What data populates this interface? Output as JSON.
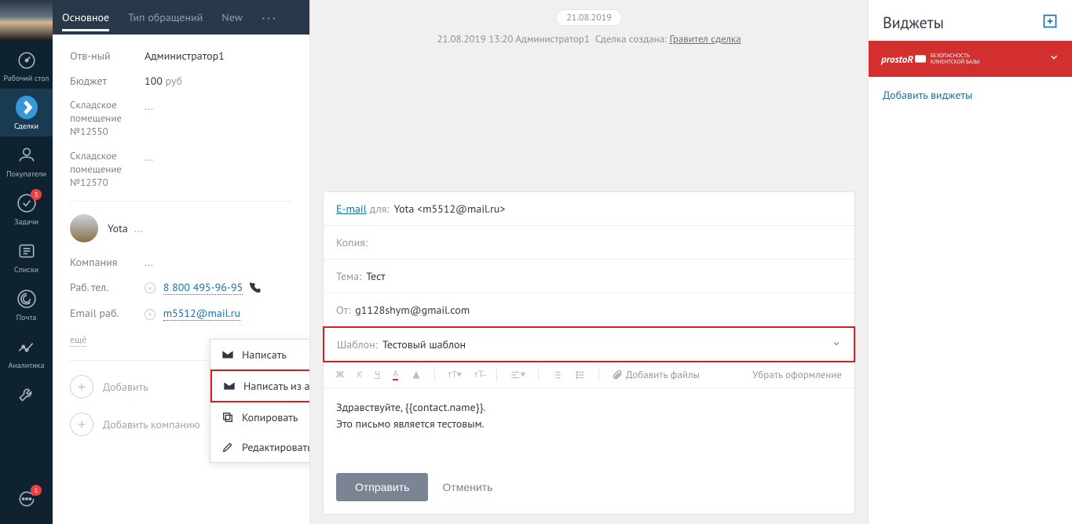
{
  "sidebar": {
    "items": [
      {
        "label": "Рабочий\nстол"
      },
      {
        "label": "Сделки"
      },
      {
        "label": "Покупатели"
      },
      {
        "label": "Задачи",
        "badge": "3"
      },
      {
        "label": "Списки"
      },
      {
        "label": "Почта"
      },
      {
        "label": "Аналитика"
      },
      {
        "label": "",
        "badge": "1"
      }
    ]
  },
  "detail": {
    "tabs": [
      "Основное",
      "Тип обращений",
      "New"
    ],
    "responsible_label": "Отв-ный",
    "responsible": "Администратор1",
    "budget_label": "Бюджет",
    "budget_value": "100",
    "budget_currency": "руб",
    "warehouse1_label": "Складское помещение №12550",
    "warehouse1_value": "...",
    "warehouse2_label": "Складское помещение №12570",
    "warehouse2_value": "...",
    "contact_name": "Yota",
    "company_label": "Компания",
    "company_value": "...",
    "phone_label": "Раб. тел.",
    "phone_value": "8 800 495-96-95",
    "email_label": "Email раб.",
    "email_value": "m5512@mail.ru",
    "more": "ещё",
    "email_menu": {
      "write": "Написать",
      "write_amo": "Написать из amoCRM",
      "copy": "Копировать",
      "edit": "Редактировать"
    },
    "add_contact": "Добавить",
    "add_company": "Добавить компанию"
  },
  "center": {
    "date": "21.08.2019",
    "sys_date": "21.08.2019 13:20",
    "sys_user": "Администратор1",
    "sys_text": "Сделка создана:",
    "sys_link": "Гравител сделка",
    "composer": {
      "email_label": "E-mail",
      "to_label": "для:",
      "to_value": "Yota <m5512@mail.ru>",
      "cc_label": "Копия:",
      "subject_label": "Тема:",
      "subject_value": "Тест",
      "from_label": "От:",
      "from_value": "g1128shym@gmail.com",
      "template_label": "Шаблон:",
      "template_value": "Тестовый шаблон",
      "attach": "Добавить файлы",
      "clear_format": "Убрать оформление",
      "body_line1": "Здравствуйте, {{contact.name}}.",
      "body_line2": "Это письмо является тестовым.",
      "send": "Отправить",
      "cancel": "Отменить"
    }
  },
  "widgets": {
    "title": "Виджеты",
    "red_logo": "prostoR",
    "red_sub1": "БЕЗОПАСНОСТЬ",
    "red_sub2": "КЛИЕНТСКОЙ БАЗЫ",
    "add_link": "Добавить виджеты"
  }
}
